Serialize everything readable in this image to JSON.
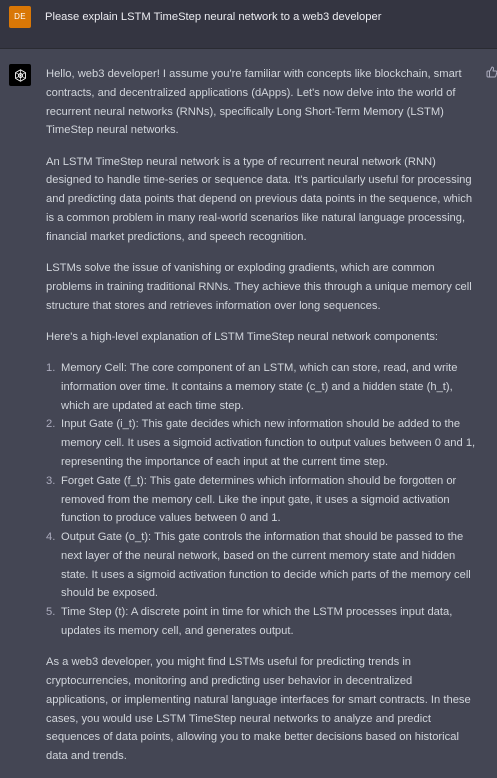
{
  "user_message": {
    "avatar_initials": "DE",
    "text": "Please explain LSTM TimeStep neural network to a web3 developer"
  },
  "assistant_message": {
    "avatar_icon": "openai-logo-icon",
    "feedback_icon": "thumbs-up-icon",
    "paragraphs": [
      "Hello, web3 developer! I assume you're familiar with concepts like blockchain, smart contracts, and decentralized applications (dApps). Let's now delve into the world of recurrent neural networks (RNNs), specifically Long Short-Term Memory (LSTM) TimeStep neural networks.",
      "An LSTM TimeStep neural network is a type of recurrent neural network (RNN) designed to handle time-series or sequence data. It's particularly useful for processing and predicting data points that depend on previous data points in the sequence, which is a common problem in many real-world scenarios like natural language processing, financial market predictions, and speech recognition.",
      "LSTMs solve the issue of vanishing or exploding gradients, which are common problems in training traditional RNNs. They achieve this through a unique memory cell structure that stores and retrieves information over long sequences.",
      "Here's a high-level explanation of LSTM TimeStep neural network components:"
    ],
    "list_items": [
      {
        "num": "1.",
        "text": "Memory Cell: The core component of an LSTM, which can store, read, and write information over time. It contains a memory state (c_t) and a hidden state (h_t), which are updated at each time step."
      },
      {
        "num": "2.",
        "text": "Input Gate (i_t): This gate decides which new information should be added to the memory cell. It uses a sigmoid activation function to output values between 0 and 1, representing the importance of each input at the current time step."
      },
      {
        "num": "3.",
        "text": "Forget Gate (f_t): This gate determines which information should be forgotten or removed from the memory cell. Like the input gate, it uses a sigmoid activation function to produce values between 0 and 1."
      },
      {
        "num": "4.",
        "text": "Output Gate (o_t): This gate controls the information that should be passed to the next layer of the neural network, based on the current memory state and hidden state. It uses a sigmoid activation function to decide which parts of the memory cell should be exposed."
      },
      {
        "num": "5.",
        "text": "Time Step (t): A discrete point in time for which the LSTM processes input data, updates its memory cell, and generates output."
      }
    ],
    "closing_paragraph": "As a web3 developer, you might find LSTMs useful for predicting trends in cryptocurrencies, monitoring and predicting user behavior in decentralized applications, or implementing natural language interfaces for smart contracts. In these cases, you would use LSTM TimeStep neural networks to analyze and predict sequences of data points, allowing you to make better decisions based on historical data and trends."
  },
  "colors": {
    "user_background": "#343541",
    "assistant_background": "#444654",
    "user_avatar": "#d97706",
    "text": "#d1d5db"
  }
}
